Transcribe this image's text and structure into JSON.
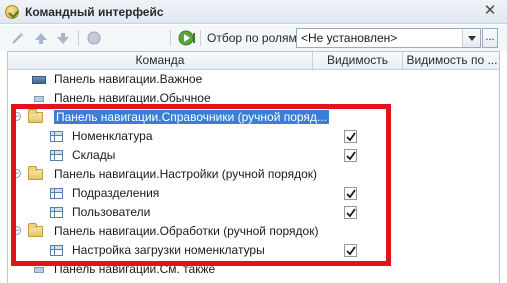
{
  "window": {
    "title": "Командный интерфейс",
    "close_glyph": "✕"
  },
  "toolbar": {
    "role_filter_label": "Отбор по ролям:",
    "role_filter_value": "<Не установлен>",
    "dots_label": "..."
  },
  "grid": {
    "columns": [
      "Команда",
      "Видимость",
      "Видимость по ..."
    ],
    "rows": [
      {
        "label": "Панель навигации.Важное",
        "icon": "nav-panel-icon",
        "level": 0,
        "has_checkbox": false
      },
      {
        "label": "Панель навигации.Обычное",
        "icon": "nav-panel-light-icon",
        "level": 0,
        "has_checkbox": false
      },
      {
        "label": "Панель навигации.Справочники (ручной поряд...",
        "icon": "folder-icon",
        "level": 0,
        "expander": "−",
        "has_checkbox": false,
        "selected": true
      },
      {
        "label": "Номенклатура",
        "icon": "catalog-table-icon",
        "level": 1,
        "has_checkbox": true,
        "checked": true
      },
      {
        "label": "Склады",
        "icon": "catalog-table-icon",
        "level": 1,
        "has_checkbox": true,
        "checked": true
      },
      {
        "label": "Панель навигации.Настройки (ручной порядок)",
        "icon": "folder-icon",
        "level": 0,
        "expander": "−",
        "has_checkbox": false
      },
      {
        "label": "Подразделения",
        "icon": "catalog-table-icon",
        "level": 1,
        "has_checkbox": true,
        "checked": true
      },
      {
        "label": "Пользователи",
        "icon": "catalog-table-icon",
        "level": 1,
        "has_checkbox": true,
        "checked": true
      },
      {
        "label": "Панель навигации.Обработки (ручной порядок)",
        "icon": "folder-icon",
        "level": 0,
        "expander": "−",
        "has_checkbox": false
      },
      {
        "label": "Настройка загрузки номенклатуры",
        "icon": "catalog-table-icon",
        "level": 1,
        "has_checkbox": true,
        "checked": true
      },
      {
        "label": "Панель навигации.См. также",
        "icon": "nav-panel-light-icon",
        "level": 0,
        "has_checkbox": false
      }
    ]
  },
  "colors": {
    "highlight": "#e3131c",
    "selection": "#3a7fd6"
  }
}
